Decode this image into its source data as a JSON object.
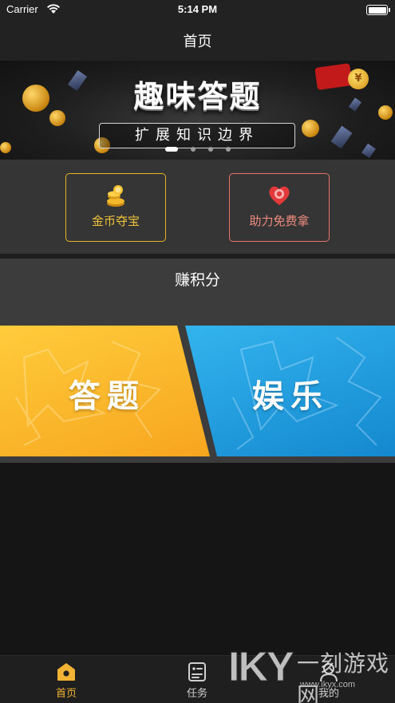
{
  "status_bar": {
    "carrier": "Carrier",
    "time": "5:14 PM"
  },
  "nav": {
    "title": "首页"
  },
  "banner": {
    "title": "趣味答题",
    "subtitle": "扩展知识边界",
    "yen_symbol": "¥",
    "page_count": 4,
    "active_page": 1
  },
  "actions": [
    {
      "label": "金币夺宝",
      "icon": "gold-coins-icon",
      "color": "#e6b422"
    },
    {
      "label": "助力免费拿",
      "icon": "red-heart-badge-icon",
      "color": "#e7756a"
    }
  ],
  "earn": {
    "title": "赚积分",
    "cards": [
      {
        "label": "答题",
        "color": "#f9b52a"
      },
      {
        "label": "娱乐",
        "color": "#25a2e2"
      }
    ]
  },
  "tabs": [
    {
      "label": "首页",
      "icon": "home-icon",
      "active": true
    },
    {
      "label": "任务",
      "icon": "task-list-icon",
      "active": false
    },
    {
      "label": "我的",
      "icon": "user-icon",
      "active": false
    }
  ],
  "watermark": {
    "logo": "IKY",
    "cn": "一刻游戏网",
    "url": "www.ikyx.com"
  },
  "colors": {
    "accent": "#f2b233",
    "background": "#151515"
  }
}
